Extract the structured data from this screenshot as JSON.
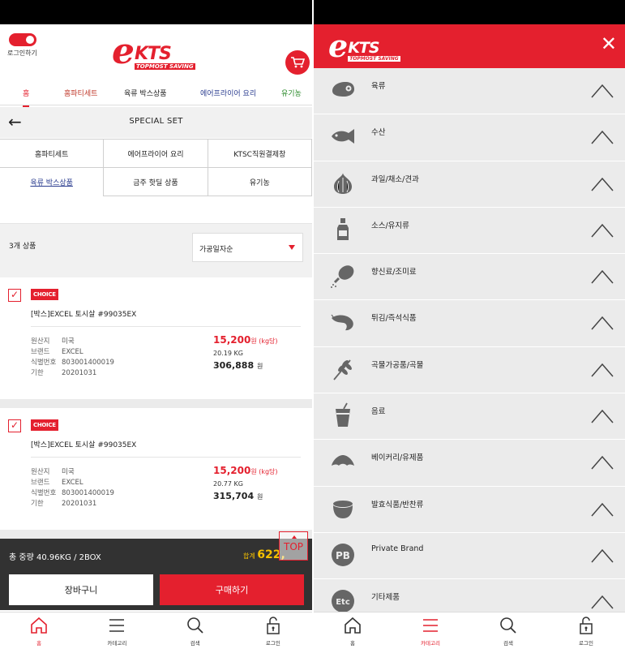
{
  "left": {
    "login_label": "로그인하기",
    "logo": {
      "letter": "e",
      "name": "KTS",
      "tagline": "TOPMOST SAVING"
    },
    "tabs": [
      "홈",
      "홈파티세트",
      "육류 박스상품",
      "에어프라이어 요리",
      "유기농"
    ],
    "tab_colors": [
      "#e4202e",
      "#c0392b",
      "#222222",
      "#2a3c8f",
      "#2a8a2a"
    ],
    "page_title": "SPECIAL SET",
    "categories": [
      [
        "홈파티세트",
        "에어프라이어 요리",
        "KTSC직원결제창"
      ],
      [
        "육류 박스상품",
        "금주 핫딜 상품",
        "유기농"
      ]
    ],
    "count": "3개 상품",
    "sort_selected": "가공일자순",
    "products": [
      {
        "badge": "CHOICE",
        "name": "[박스]EXCEL 토시살 #99035EX",
        "spec_keys": [
          "원산지",
          "브랜드",
          "식별번호",
          "기한"
        ],
        "spec_values": [
          "미국",
          "EXCEL",
          "803001400019",
          "20201031"
        ],
        "price": "15,200",
        "price_unit": "원 (kg당)",
        "weight": "20.19 KG",
        "total": "306,888",
        "won": "원"
      },
      {
        "badge": "CHOICE",
        "name": "[박스]EXCEL 토시살 #99035EX",
        "spec_keys": [
          "원산지",
          "브랜드",
          "식별번호",
          "기한"
        ],
        "spec_values": [
          "미국",
          "EXCEL",
          "803001400019",
          "20201031"
        ],
        "price": "15,200",
        "price_unit": "원 (kg당)",
        "weight": "20.77 KG",
        "total": "315,704",
        "won": "원"
      }
    ],
    "summary": {
      "left": "총 중량 40.96KG / 2BOX",
      "right_label": "합계",
      "right_value": "622,"
    },
    "top_button": "TOP",
    "cart_button": "장바구니",
    "buy_button": "구매하기"
  },
  "nav": [
    {
      "label": "홈",
      "icon": "home-icon"
    },
    {
      "label": "카테고리",
      "icon": "menu-icon"
    },
    {
      "label": "검색",
      "icon": "search-icon"
    },
    {
      "label": "로그인",
      "icon": "lock-icon"
    }
  ],
  "right": {
    "close": "✕",
    "categories": [
      {
        "label": "육류",
        "icon": "meat-icon"
      },
      {
        "label": "수산",
        "icon": "fish-icon"
      },
      {
        "label": "과일/채소/견과",
        "icon": "garlic-icon"
      },
      {
        "label": "소스/유지류",
        "icon": "sauce-bottle-icon"
      },
      {
        "label": "향신료/조미료",
        "icon": "drumstick-icon"
      },
      {
        "label": "튀김/즉석식품",
        "icon": "shrimp-icon"
      },
      {
        "label": "곡물가공품/곡물",
        "icon": "wheat-icon"
      },
      {
        "label": "음료",
        "icon": "drink-icon"
      },
      {
        "label": "베이커리/유제품",
        "icon": "croissant-icon"
      },
      {
        "label": "발효식품/반찬류",
        "icon": "pot-icon"
      },
      {
        "label": "Private Brand",
        "icon": "pb-icon"
      },
      {
        "label": "기타제품",
        "icon": "etc-icon"
      }
    ]
  },
  "colors": {
    "accent": "#e4202e",
    "dark": "#323232",
    "gold": "#f5c000"
  }
}
